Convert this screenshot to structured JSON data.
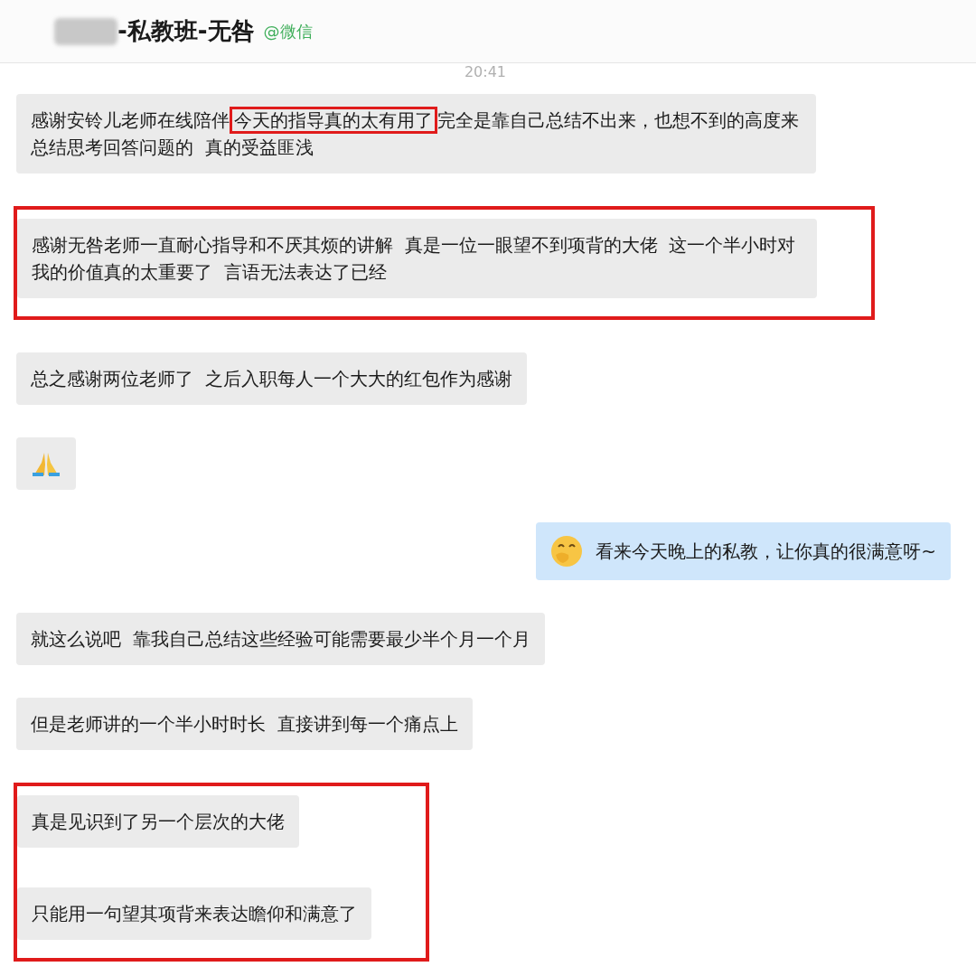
{
  "header": {
    "title": "-私教班-无咎",
    "source": "@微信",
    "title_redacted": true
  },
  "timestamp": "20:41",
  "messages": [
    {
      "kind": "text",
      "boxed": false,
      "segments": [
        {
          "text": "感谢安铃儿老师在线陪伴",
          "marked": false
        },
        {
          "text": "今天的指导真的太有用了",
          "marked": true
        },
        {
          "text": "完全是靠自己总结不出来，也想不到的高度来总结思考回答问题的  真的受益匪浅",
          "marked": false
        }
      ]
    },
    {
      "kind": "text",
      "boxed": true,
      "segments": [
        {
          "text": "感谢无咎老师一直耐心指导和不厌其烦的讲解  真是一位一眼望不到项背的大佬  这一个半小时对我的价值真的太重要了  言语无法表达了已经",
          "marked": false
        }
      ]
    },
    {
      "kind": "text",
      "boxed": false,
      "segments": [
        {
          "text": "总之感谢两位老师了  之后入职每人一个大大的红包作为感谢",
          "marked": false
        }
      ]
    },
    {
      "kind": "praying-hands",
      "boxed": false
    },
    {
      "kind": "outgoing-face-text",
      "boxed": false,
      "segments": [
        {
          "text": "看来今天晚上的私教，让你真的很满意呀~",
          "marked": false
        }
      ]
    },
    {
      "kind": "text",
      "boxed": false,
      "segments": [
        {
          "text": "就这么说吧  靠我自己总结这些经验可能需要最少半个月一个月",
          "marked": false
        }
      ]
    },
    {
      "kind": "text",
      "boxed": false,
      "segments": [
        {
          "text": "但是老师讲的一个半小时时长  直接讲到每一个痛点上",
          "marked": false
        }
      ]
    },
    {
      "kind": "text",
      "boxed": true,
      "segments": [
        {
          "text": "真是见识到了另一个层次的大佬",
          "marked": false
        }
      ]
    },
    {
      "kind": "text",
      "boxed": true,
      "segments": [
        {
          "text": "只能用一句望其项背来表达瞻仰和满意了",
          "marked": false
        }
      ]
    }
  ]
}
